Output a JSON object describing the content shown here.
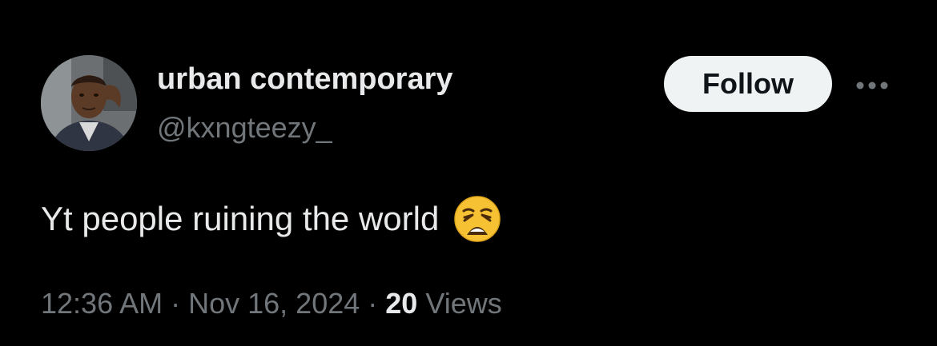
{
  "user": {
    "display_name": "urban contemporary",
    "handle": "@kxngteezy_"
  },
  "actions": {
    "follow_label": "Follow",
    "more_icon": "more-horizontal-icon"
  },
  "tweet": {
    "text": "Yt people ruining the world",
    "emoji": "weary-face-emoji"
  },
  "meta": {
    "time": "12:36 AM",
    "separator": "·",
    "date": "Nov 16, 2024",
    "views_count": "20",
    "views_label": "Views"
  },
  "colors": {
    "background": "#000000",
    "primary_text": "#e7e9ea",
    "secondary_text": "#71767b",
    "follow_button_bg": "#eff3f4",
    "follow_button_text": "#0f1419"
  }
}
